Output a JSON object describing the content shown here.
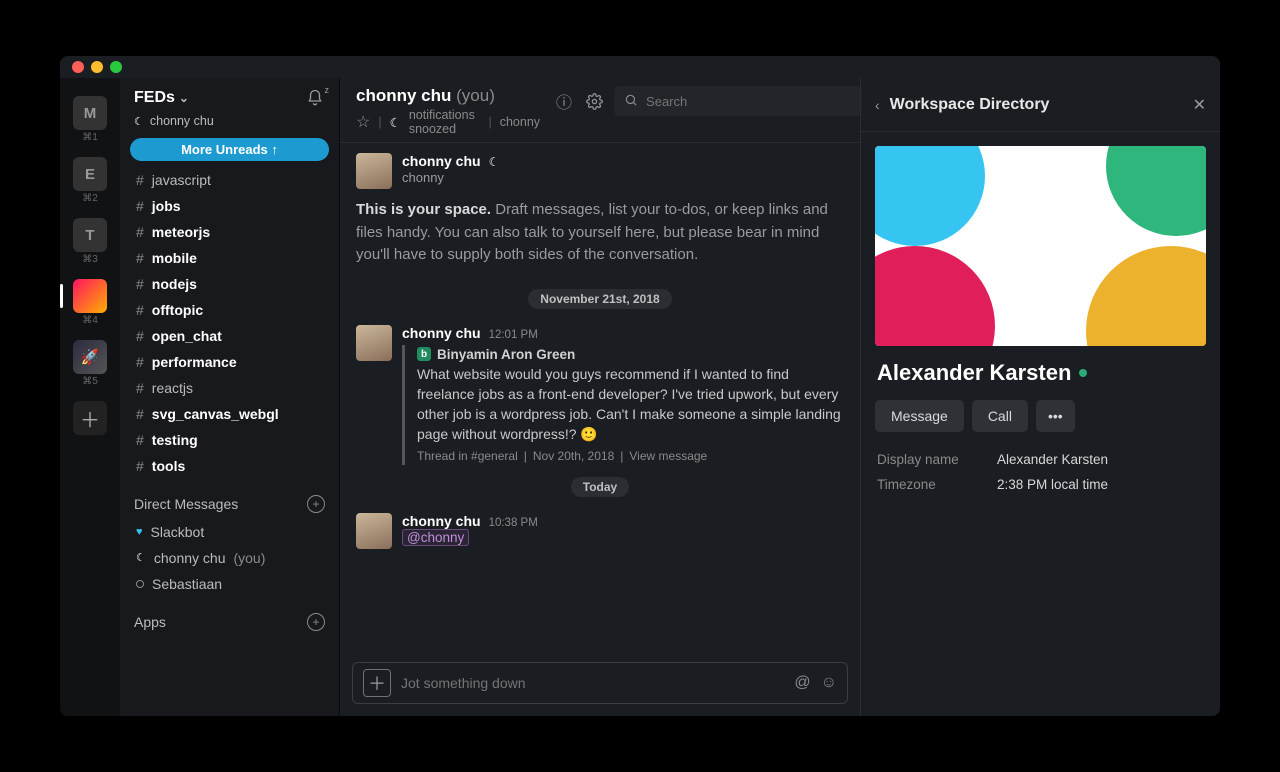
{
  "rail": {
    "workspaces": [
      {
        "letter": "M",
        "shortcut": "⌘1"
      },
      {
        "letter": "E",
        "shortcut": "⌘2"
      },
      {
        "letter": "T",
        "shortcut": "⌘3"
      },
      {
        "letter": "",
        "shortcut": "⌘4",
        "active": true
      },
      {
        "letter": "",
        "shortcut": "⌘5"
      }
    ]
  },
  "sidebar": {
    "workspace_name": "FEDs",
    "user_name": "chonny chu",
    "more_unreads": "More Unreads",
    "channels": [
      {
        "name": "javascript",
        "bold": false
      },
      {
        "name": "jobs",
        "bold": true
      },
      {
        "name": "meteorjs",
        "bold": true
      },
      {
        "name": "mobile",
        "bold": true
      },
      {
        "name": "nodejs",
        "bold": true
      },
      {
        "name": "offtopic",
        "bold": true
      },
      {
        "name": "open_chat",
        "bold": true
      },
      {
        "name": "performance",
        "bold": true
      },
      {
        "name": "reactjs",
        "bold": false
      },
      {
        "name": "svg_canvas_webgl",
        "bold": true
      },
      {
        "name": "testing",
        "bold": true
      },
      {
        "name": "tools",
        "bold": true
      }
    ],
    "dm_header": "Direct Messages",
    "dms": [
      {
        "name": "Slackbot",
        "presence": "heart"
      },
      {
        "name": "chonny chu",
        "presence": "active",
        "suffix": "(you)"
      },
      {
        "name": "Sebastiaan",
        "presence": "away"
      }
    ],
    "apps_header": "Apps"
  },
  "header": {
    "name": "chonny chu",
    "suffix": "(you)",
    "notif_text": "notifications snoozed",
    "username": "chonny",
    "search_placeholder": "Search"
  },
  "intro": {
    "msg_name": "chonny chu",
    "msg_sub": "chonny",
    "bold": "This is your space.",
    "body": "Draft messages, list your to-dos, or keep links and files handy. You can also talk to yourself here, but please bear in mind you'll have to supply both sides of the conversation."
  },
  "divider1": "November 21st, 2018",
  "message1": {
    "name": "chonny chu",
    "time": "12:01 PM",
    "quote_author": "Binyamin Aron Green",
    "quote_body": "What website would you guys recommend if I wanted to find freelance jobs as a front-end developer? I've tried upwork, but every other job is a wordpress job. Can't I make someone a simple landing page without wordpress!? 🙂",
    "quote_meta_thread": "Thread in #general",
    "quote_meta_date": "Nov 20th, 2018",
    "quote_meta_view": "View message"
  },
  "divider2": "Today",
  "message2": {
    "name": "chonny chu",
    "time": "10:38 PM",
    "mention": "@chonny"
  },
  "composer_placeholder": "Jot something down",
  "panel": {
    "title": "Workspace Directory",
    "name": "Alexander Karsten",
    "btn_message": "Message",
    "btn_call": "Call",
    "label_display": "Display name",
    "value_display": "Alexander Karsten",
    "label_tz": "Timezone",
    "value_tz": "2:38 PM local time"
  }
}
